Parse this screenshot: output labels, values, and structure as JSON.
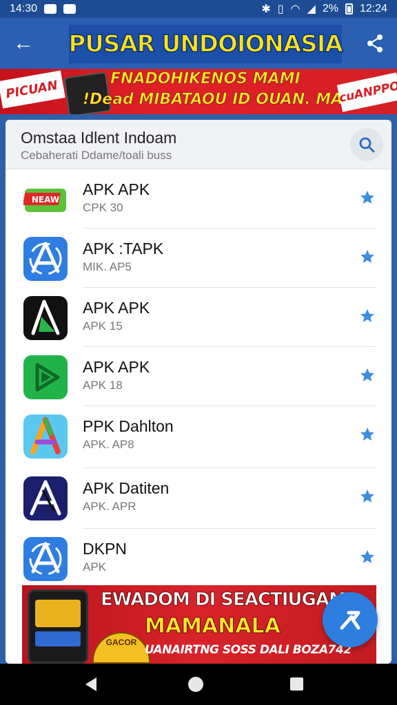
{
  "status_bar": {
    "time_left": "14:30",
    "battery": "2%",
    "time_right": "12:24"
  },
  "app_bar": {
    "title": "PUSAR UNDOIONASIA"
  },
  "top_banner": {
    "line1": "FNADOHIKENOS MAMI",
    "line2": "!Dead MIBATAOU ID OUAN. MAPK",
    "left_sticker": "PICUAN",
    "right_sticker": "cuANPPO"
  },
  "search": {
    "title": "Omstaa Idlent Indoam",
    "subtitle": "Cebaherati Ddame/toali buss"
  },
  "apps": [
    {
      "name": "APK APK",
      "sub": "CPK 30",
      "icon": "new-badge-icon",
      "icon_text": "NEAW"
    },
    {
      "name": "APK :TAPK",
      "sub": "MIK. AP5",
      "icon": "blue-a-icon"
    },
    {
      "name": "APK APK",
      "sub": "APK 15",
      "icon": "black-green-a-icon"
    },
    {
      "name": "APK APK",
      "sub": "APK 18",
      "icon": "green-play-icon"
    },
    {
      "name": "PPK Dahlton",
      "sub": "APK. AP8",
      "icon": "colorful-a-icon"
    },
    {
      "name": "APK Datiten",
      "sub": "APK. APR",
      "icon": "navy-a-icon"
    },
    {
      "name": "DKPN",
      "sub": "APK",
      "icon": "blue-a-icon"
    }
  ],
  "bottom_banner": {
    "line1": "EWADOM DI SEACTIUGAMI",
    "line2": "MAMANALA",
    "line3": "UANAIRTNG SOSS DALI BOZA742",
    "coin_text": "GACOR"
  },
  "colors": {
    "primary": "#2a5fb1",
    "star": "#3d8de0",
    "banner_red": "#d9232a",
    "banner_yellow": "#ffe52a"
  }
}
